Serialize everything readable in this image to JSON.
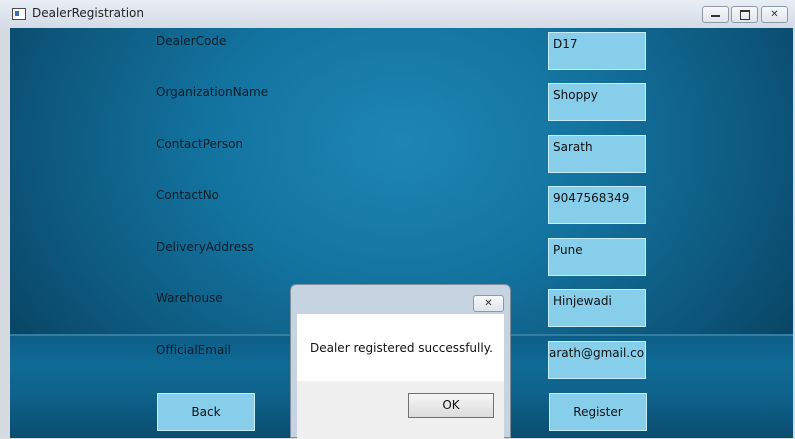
{
  "window": {
    "title": "DealerRegistration",
    "minimize_icon": "minimize-icon",
    "maximize_icon": "restore-icon",
    "close_icon": "close-icon",
    "close_glyph": "✕"
  },
  "form": {
    "labels": {
      "dealer_code": "DealerCode",
      "organization_name": "OrganizationName",
      "contact_person": "ContactPerson",
      "contact_no": "ContactNo",
      "delivery_address": "DeliveryAddress",
      "warehouse": "Warehouse",
      "official_email": "OfficialEmail"
    },
    "values": {
      "dealer_code": "D17",
      "organization_name": "Shoppy",
      "contact_person": "Sarath",
      "contact_no": "9047568349",
      "delivery_address": "Pune",
      "warehouse": "Hinjewadi",
      "official_email": "arath@gmail.com"
    }
  },
  "buttons": {
    "back": "Back",
    "register": "Register"
  },
  "dialog": {
    "message": "Dealer registered successfully.",
    "ok": "OK",
    "close_glyph": "✕"
  },
  "colors": {
    "field_background": "#87ceeb",
    "client_background": "#13739f"
  }
}
